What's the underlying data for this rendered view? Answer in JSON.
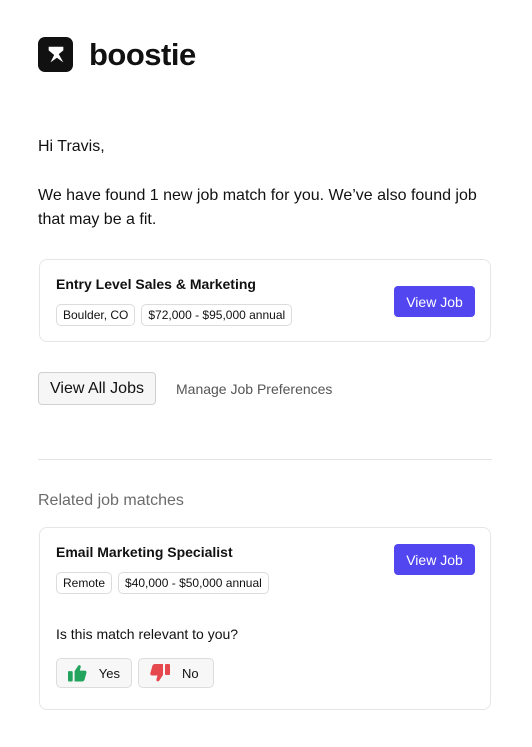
{
  "brand": {
    "name": "boostie",
    "logo_icon": "boostie-bird-icon"
  },
  "email": {
    "greeting": "Hi Travis,",
    "intro": "We have found 1 new job match for you. We’ve also found job that may be a fit."
  },
  "main_match": {
    "title": "Entry Level Sales & Marketing",
    "location": "Boulder, CO",
    "salary": "$72,000 - $95,000 annual",
    "view_label": "View Job"
  },
  "actions": {
    "view_all_label": "View All Jobs",
    "manage_label": "Manage Job Preferences"
  },
  "related": {
    "heading": "Related job matches",
    "job": {
      "title": "Email Marketing Specialist",
      "location": "Remote",
      "salary": "$40,000 - $50,000 annual",
      "view_label": "View Job"
    },
    "question": "Is this match relevant to you?",
    "yes_label": "Yes",
    "no_label": "No",
    "yes_icon": "thumbs-up-icon",
    "no_icon": "thumbs-down-icon"
  },
  "colors": {
    "primary": "#5146f0",
    "yes_green": "#22a45d",
    "no_red": "#e5484d"
  }
}
